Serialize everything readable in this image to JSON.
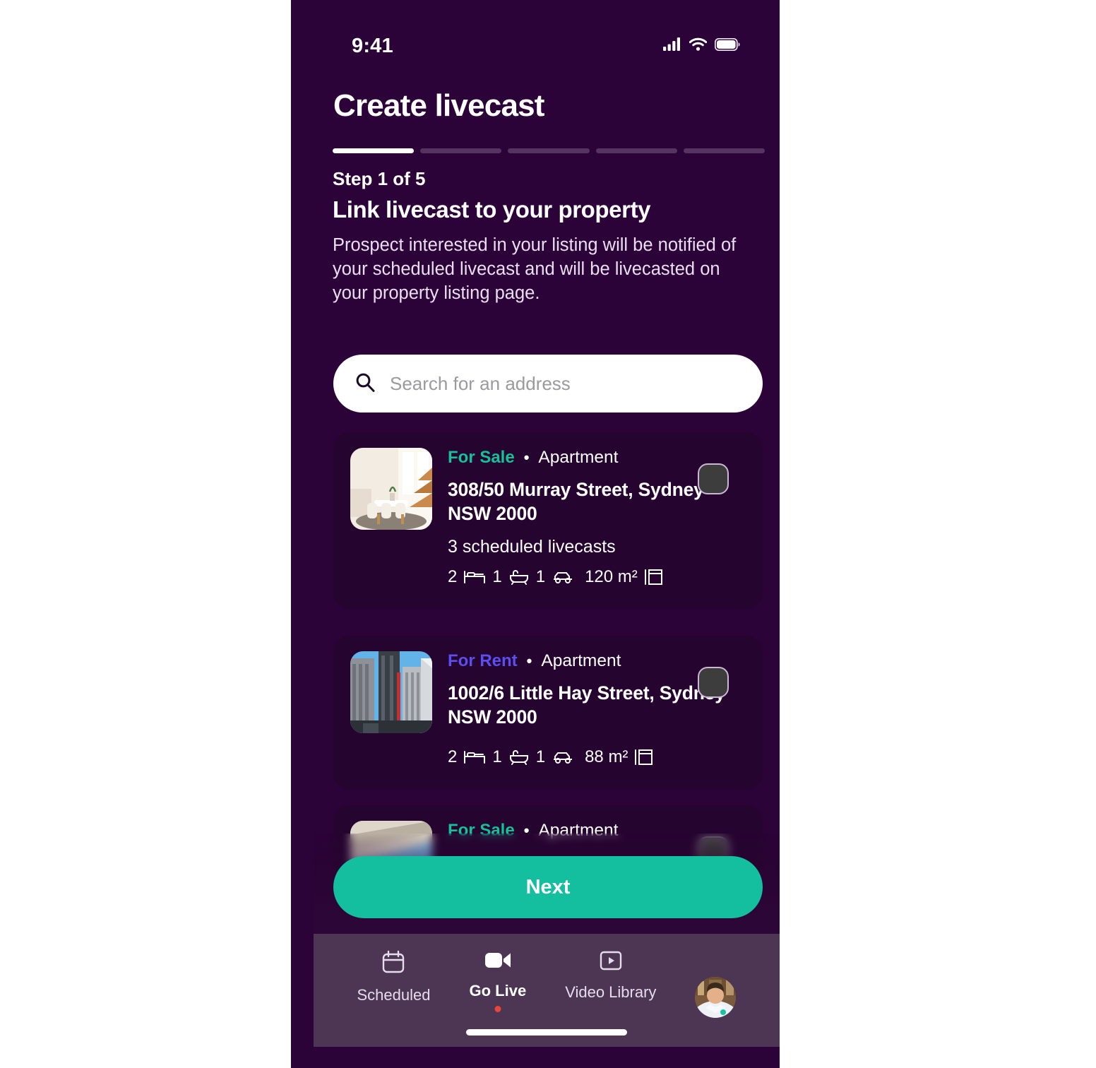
{
  "statusbar": {
    "time": "9:41",
    "signal_icon": "cellular-signal-icon",
    "wifi_icon": "wifi-icon",
    "battery_icon": "battery-icon"
  },
  "header": {
    "title": "Create livecast",
    "step_label": "Step 1 of 5",
    "step_heading": "Link livecast to your property",
    "step_description": "Prospect interested in your listing will be notified of your scheduled livecast and will be livecasted on your property listing page.",
    "progress": {
      "total_steps": 5,
      "current_step": 1
    }
  },
  "search": {
    "placeholder": "Search for an address",
    "value": "",
    "icon": "search-icon"
  },
  "properties": [
    {
      "status": "For Sale",
      "status_color": "#14c29a",
      "separator": "•",
      "type": "Apartment",
      "address": "308/50 Murray Street, Sydney NSW 2000",
      "scheduled": "3 scheduled livecasts",
      "beds": "2",
      "baths": "1",
      "cars": "1",
      "area": "120 m²",
      "selected": false,
      "thumbnail": "interior-dining-room-photo"
    },
    {
      "status": "For Rent",
      "status_color": "#5b4ff0",
      "separator": "•",
      "type": "Apartment",
      "address": "1002/6 Little Hay Street, Sydney NSW 2000",
      "scheduled": "",
      "beds": "2",
      "baths": "1",
      "cars": "1",
      "area": "88 m²",
      "selected": false,
      "thumbnail": "city-skyscrapers-photo"
    },
    {
      "status": "For Sale",
      "status_color": "#14c29a",
      "separator": "•",
      "type": "Apartment",
      "address": "",
      "scheduled": "",
      "beds": "",
      "baths": "",
      "cars": "",
      "area": "",
      "selected": false,
      "thumbnail": "building-exterior-photo"
    }
  ],
  "primary_action": {
    "label": "Next"
  },
  "bottom_nav": {
    "items": [
      {
        "label": "Scheduled",
        "icon": "calendar-icon",
        "active": false
      },
      {
        "label": "Go Live",
        "icon": "video-camera-icon",
        "active": true
      },
      {
        "label": "Video Library",
        "icon": "play-box-icon",
        "active": false
      }
    ],
    "avatar": "user-avatar-photo"
  },
  "colors": {
    "background": "#2c0338",
    "card_background": "#260430",
    "accent_teal": "#14bfa0",
    "accent_violet": "#5b4ff0",
    "nav_background": "#4c3653",
    "live_dot": "#e8453c"
  }
}
